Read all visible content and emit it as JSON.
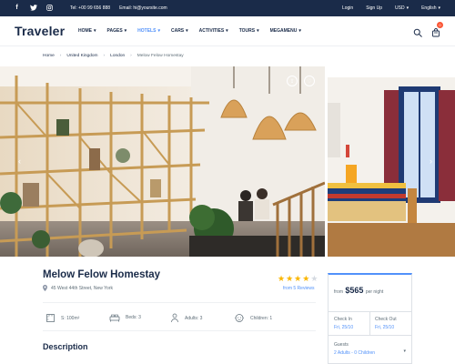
{
  "topbar": {
    "social": [
      {
        "icon": "facebook-icon",
        "glyph": "f"
      },
      {
        "icon": "twitter-icon",
        "glyph": "𝕥"
      },
      {
        "icon": "instagram-icon",
        "glyph": "◎"
      }
    ],
    "phone": "Tel: +00 99 656 888",
    "email": "Email: hi@yoursite.com",
    "login": "Login",
    "signup": "Sign Up",
    "currency": "USD",
    "language": "English"
  },
  "nav": {
    "logo": "Traveler",
    "menu": [
      {
        "label": "HOME",
        "active": false
      },
      {
        "label": "PAGES",
        "active": false
      },
      {
        "label": "HOTELS",
        "active": true
      },
      {
        "label": "CARS",
        "active": false
      },
      {
        "label": "ACTIVITIES",
        "active": false
      },
      {
        "label": "TOURS",
        "active": false
      },
      {
        "label": "MEGAMENU",
        "active": false
      }
    ],
    "cart_count": "0"
  },
  "breadcrumb": {
    "items": [
      "Home",
      "United Kingdom",
      "London"
    ],
    "current": "Melow Felow Homestay"
  },
  "listing": {
    "title": "Melow Felow Homestay",
    "address": "45 West 44th Street, New York",
    "rating": 4,
    "rating_max": 5,
    "reviews": "from 5 Reviews",
    "facts": {
      "area": "S: 100m²",
      "beds": "Beds: 3",
      "adults": "Adults: 3",
      "children": "Children: 1"
    },
    "description_heading": "Description"
  },
  "booking": {
    "from": "from",
    "price": "$565",
    "per": "per night",
    "checkin_label": "Check In",
    "checkin_value": "Fri, 25/10",
    "checkout_label": "Check Out",
    "checkout_value": "Fri, 25/10",
    "guests_label": "Guests",
    "guests_value": "2 Adults - 0 Children"
  },
  "colors": {
    "navy": "#1a2b49",
    "accent": "#5191fa",
    "star": "#fab600",
    "badge": "#fa5636"
  }
}
